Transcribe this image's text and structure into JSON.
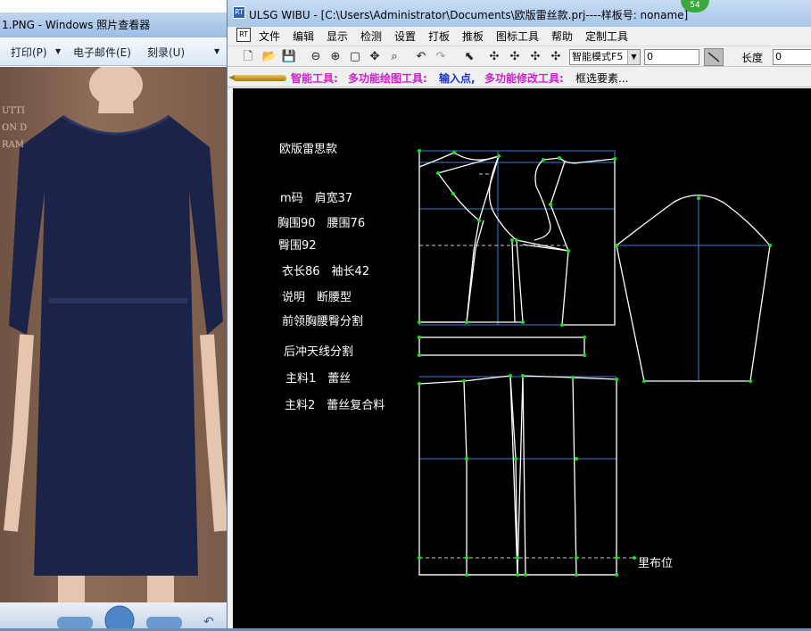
{
  "viewer": {
    "title": "1.PNG - Windows 照片查看器",
    "menu": [
      "打印(P)",
      "电子邮件(E)",
      "刻录(U)"
    ],
    "photo_text": [
      "UTTI",
      "ON D",
      "RAM"
    ]
  },
  "app": {
    "title": "ULSG WIBU - [C:\\Users\\Administrator\\Documents\\欧版雷丝款.prj----样板号: noname]",
    "icon": "RT",
    "badge": "54",
    "menu": [
      "文件",
      "编辑",
      "显示",
      "检测",
      "设置",
      "打板",
      "推板",
      "图标工具",
      "帮助",
      "定制工具"
    ],
    "mode": "智能模式F5",
    "input1": "0",
    "length_label": "长度",
    "input2": "0",
    "status": {
      "smart": "智能工具:",
      "draw": "多功能绘图工具:",
      "input": "输入点,",
      "modify": "多功能修改工具:",
      "select": "框选要素..."
    }
  },
  "pattern": {
    "style_name": "欧版雷思款",
    "size": "m码　肩宽37",
    "bust_waist": "胸围90　腰围76",
    "hip": "臀围92",
    "lengths": "衣长86　袖长42",
    "note": "说明　断腰型",
    "split": "前领胸腰臀分割",
    "back": "后冲天线分割",
    "fabric1": "主料1　蕾丝",
    "fabric2": "主料2　蕾丝复合料",
    "lining": "里布位"
  },
  "colors": {
    "guide": "#3a7fd0",
    "outline": "#ffffff",
    "point": "#22dd22",
    "dashed": "#cfcfcf"
  }
}
